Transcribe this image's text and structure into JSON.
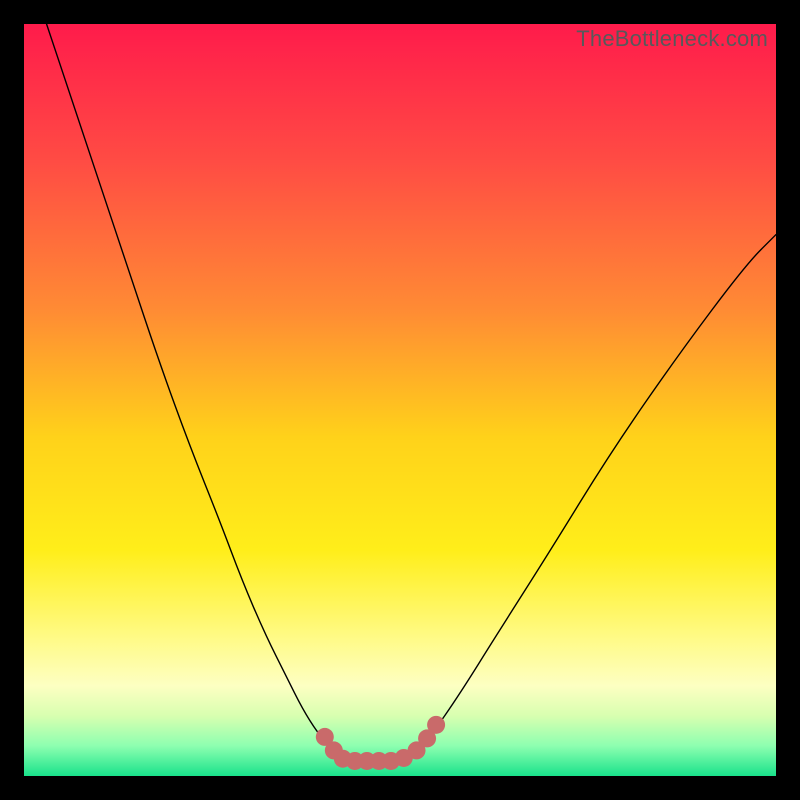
{
  "watermark": "TheBottleneck.com",
  "chart_data": {
    "type": "line",
    "title": "",
    "xlabel": "",
    "ylabel": "",
    "xlim": [
      0,
      100
    ],
    "ylim": [
      0,
      100
    ],
    "grid": false,
    "legend": false,
    "annotations": [],
    "background_gradient": {
      "stops": [
        {
          "offset": 0.0,
          "color": "#ff1b4b"
        },
        {
          "offset": 0.18,
          "color": "#ff4b44"
        },
        {
          "offset": 0.38,
          "color": "#ff8b34"
        },
        {
          "offset": 0.55,
          "color": "#ffd21a"
        },
        {
          "offset": 0.7,
          "color": "#ffee1a"
        },
        {
          "offset": 0.82,
          "color": "#fffb8a"
        },
        {
          "offset": 0.88,
          "color": "#fdffc2"
        },
        {
          "offset": 0.92,
          "color": "#d8ffb0"
        },
        {
          "offset": 0.96,
          "color": "#8dffb0"
        },
        {
          "offset": 1.0,
          "color": "#19e28b"
        }
      ]
    },
    "series": [
      {
        "name": "bottleneck-curve",
        "stroke": "#000000",
        "stroke_width": 1.4,
        "x": [
          3,
          6,
          10,
          14,
          18,
          22,
          26,
          29,
          32,
          35,
          37,
          39,
          41,
          42.5,
          44,
          46,
          48,
          50,
          52,
          54,
          58,
          63,
          70,
          78,
          87,
          96,
          100
        ],
        "y": [
          100,
          91,
          79,
          67,
          55,
          44,
          34,
          26,
          19,
          13,
          9,
          5.8,
          3.5,
          2.4,
          2.0,
          2.0,
          2.0,
          2.2,
          3.0,
          5.2,
          11,
          19,
          30,
          43,
          56,
          68,
          72
        ]
      }
    ],
    "markers": {
      "name": "valley-markers",
      "color": "#c96a6a",
      "radius": 9,
      "points": [
        {
          "x": 40.0,
          "y": 5.2
        },
        {
          "x": 41.2,
          "y": 3.4
        },
        {
          "x": 42.4,
          "y": 2.3
        },
        {
          "x": 44.0,
          "y": 2.0
        },
        {
          "x": 45.6,
          "y": 2.0
        },
        {
          "x": 47.2,
          "y": 2.0
        },
        {
          "x": 48.8,
          "y": 2.0
        },
        {
          "x": 50.5,
          "y": 2.4
        },
        {
          "x": 52.2,
          "y": 3.4
        },
        {
          "x": 53.6,
          "y": 5.0
        },
        {
          "x": 54.8,
          "y": 6.8
        }
      ]
    }
  }
}
